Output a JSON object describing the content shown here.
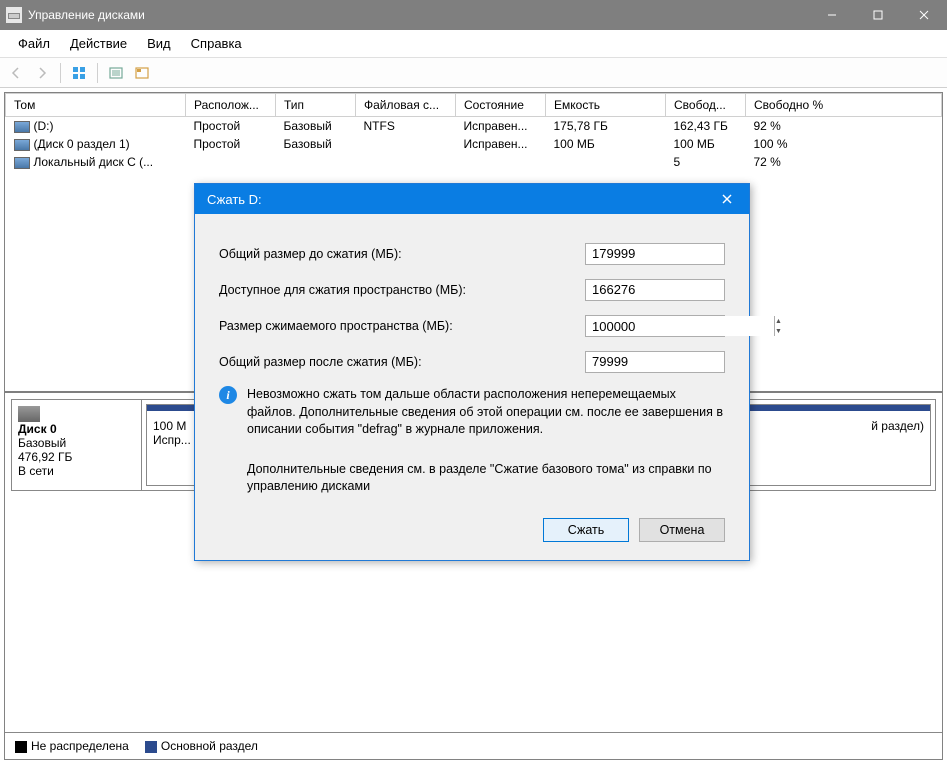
{
  "window": {
    "title": "Управление дисками"
  },
  "menu": {
    "file": "Файл",
    "action": "Действие",
    "view": "Вид",
    "help": "Справка"
  },
  "columns": {
    "volume": "Том",
    "layout": "Располож...",
    "type": "Тип",
    "fs": "Файловая с...",
    "status": "Состояние",
    "capacity": "Емкость",
    "free": "Свобод...",
    "freepct": "Свободно %"
  },
  "volumes": [
    {
      "name": "(D:)",
      "layout": "Простой",
      "type": "Базовый",
      "fs": "NTFS",
      "status": "Исправен...",
      "capacity": "175,78 ГБ",
      "free": "162,43 ГБ",
      "pct": "92 %"
    },
    {
      "name": "(Диск 0 раздел 1)",
      "layout": "Простой",
      "type": "Базовый",
      "fs": "",
      "status": "Исправен...",
      "capacity": "100 МБ",
      "free": "100 МБ",
      "pct": "100 %"
    },
    {
      "name": "Локальный диск C (...",
      "layout": "",
      "type": "",
      "fs": "",
      "status": "",
      "capacity": "",
      "free": "5",
      "pct": "72 %"
    }
  ],
  "disk": {
    "label": "Диск 0",
    "type": "Базовый",
    "size": "476,92 ГБ",
    "status": "В сети",
    "p1_size": "100 М",
    "p1_status": "Испр...",
    "p_last": "й раздел)"
  },
  "legend": {
    "unalloc": "Не распределена",
    "primary": "Основной раздел"
  },
  "dialog": {
    "title": "Сжать D:",
    "total_before_label": "Общий размер до сжатия (МБ):",
    "total_before": "179999",
    "avail_label": "Доступное для сжатия пространство (МБ):",
    "avail": "166276",
    "shrink_label": "Размер сжимаемого пространства (МБ):",
    "shrink": "100000",
    "total_after_label": "Общий размер после сжатия (МБ):",
    "total_after": "79999",
    "info1": "Невозможно сжать том дальше области расположения неперемещаемых файлов. Дополнительные сведения об этой операции см. после ее завершения в описании события \"defrag\" в журнале приложения.",
    "info2": "Дополнительные сведения см. в разделе \"Сжатие базового тома\" из справки по управлению дисками",
    "ok": "Сжать",
    "cancel": "Отмена"
  }
}
